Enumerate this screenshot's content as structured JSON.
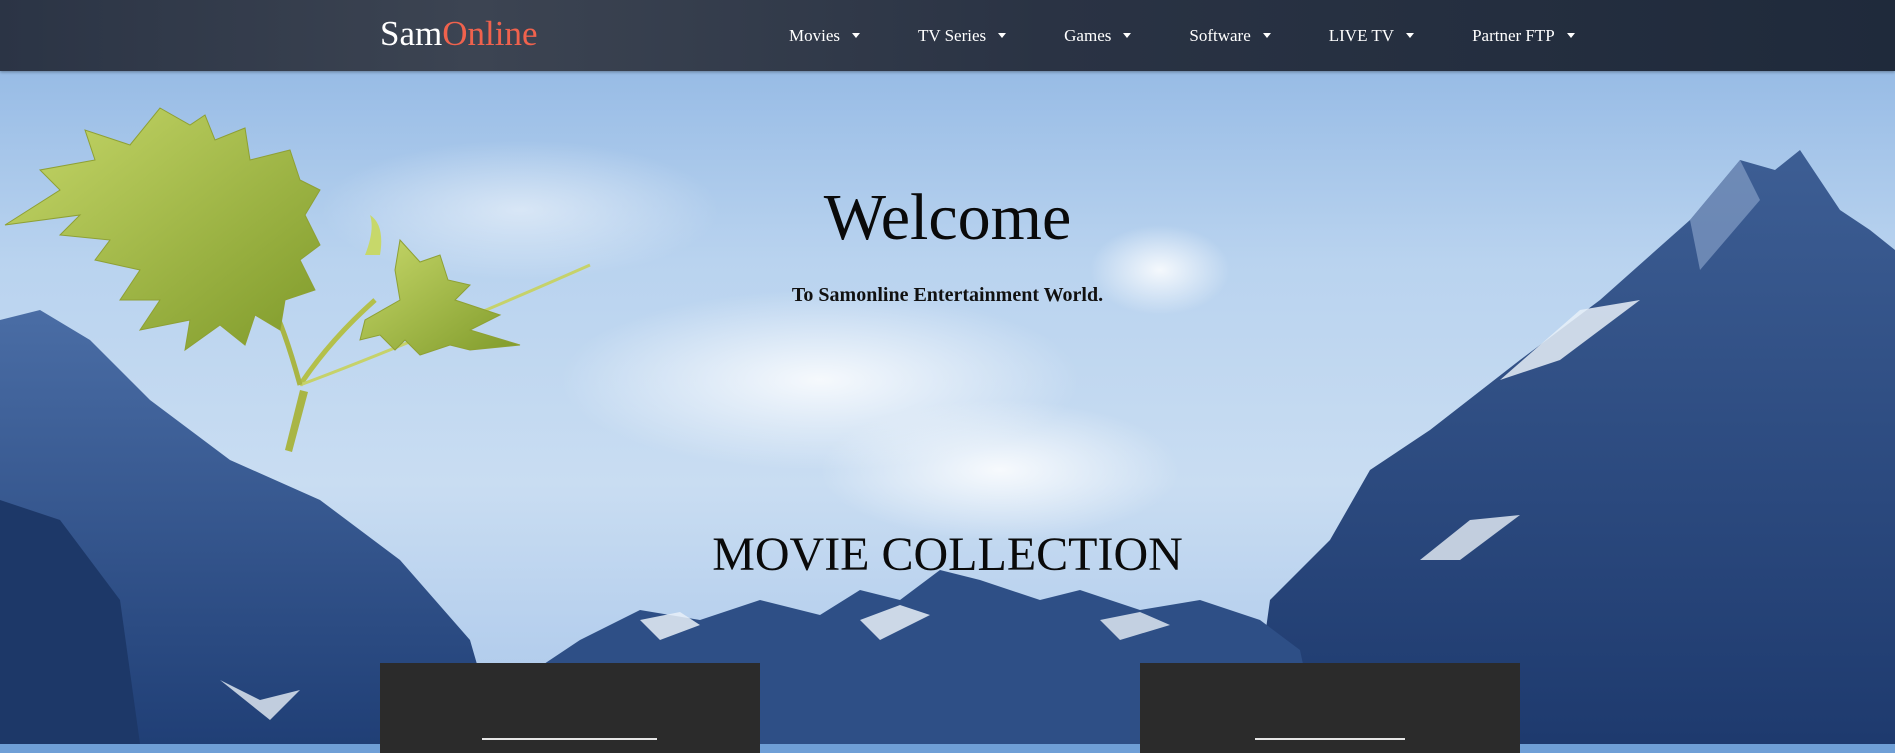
{
  "brand": {
    "part1": "Sam",
    "part2": "Online"
  },
  "nav": {
    "items": [
      {
        "label": "Movies"
      },
      {
        "label": "TV Series"
      },
      {
        "label": "Games"
      },
      {
        "label": "Software"
      },
      {
        "label": "LIVE TV"
      },
      {
        "label": "Partner FTP"
      }
    ]
  },
  "hero": {
    "title": "Welcome",
    "subtitle": "To Samonline Entertainment World."
  },
  "section": {
    "title": "MOVIE COLLECTION"
  },
  "colors": {
    "navbar_bg": "#2b3445",
    "brand_accent": "#f0624d",
    "nav_text": "#ffffff",
    "card_bg": "#2b2b2b"
  },
  "icons": [
    "caret-down-icon",
    "leaf-decoration"
  ]
}
